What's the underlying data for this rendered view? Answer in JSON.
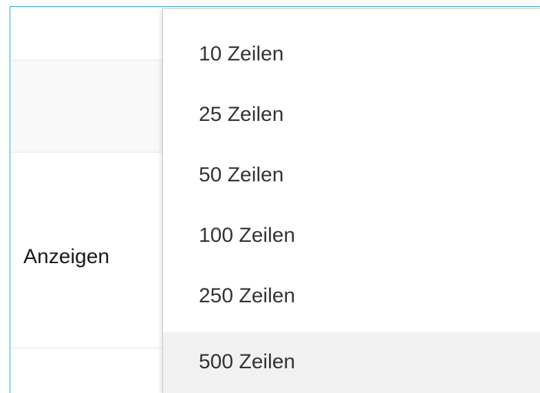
{
  "table_controls": {
    "show_label": "Anzeigen"
  },
  "page_length_menu": {
    "options": [
      "10 Zeilen",
      "25 Zeilen",
      "50 Zeilen",
      "100 Zeilen",
      "250 Zeilen",
      "500 Zeilen"
    ],
    "highlighted_option": "500 Zeilen"
  },
  "colors": {
    "frame_border": "#29a9d8",
    "highlight_bg": "#f1f1f1"
  }
}
